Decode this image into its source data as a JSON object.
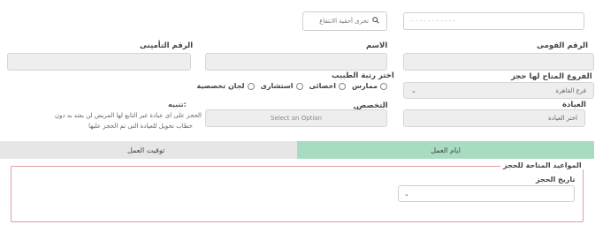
{
  "top": {
    "national_id_value": "- - - - - - - - -  - -",
    "search_placeholder": "تحرى أحقية الانتفاع"
  },
  "labels": {
    "national_id": "الرقم القومى",
    "name": "الاسم",
    "insurance_number": "الرقم التأمينى",
    "branches": "الفروع المتاح لها حجز",
    "doctor_rank": "اختر رتبة الطبيب",
    "clinic": "العيادة",
    "specialty": "التخصص",
    "note_title": "تنبيه:",
    "note_text_line1": "الحجز على اى عيادة غير التابع لها المريض لن يعتد به دون",
    "note_text_line2": "خطاب تحويل للعيادة التى تم الحجز عليها"
  },
  "selects": {
    "branch_value": "فرع القاهرة",
    "clinic_value": "اختر العيادة",
    "specialty_placeholder": "Select an Option"
  },
  "radios": [
    {
      "label": "ممارس"
    },
    {
      "label": "اخصائى"
    },
    {
      "label": "استشارى"
    },
    {
      "label": "لجان تخصصية"
    }
  ],
  "tabs": {
    "work_days": "ايام العمل",
    "work_time": "توقيت العمل"
  },
  "appointments": {
    "legend": "المواعيد المتاحة للحجز",
    "date_label": "تاريخ الحجز"
  },
  "colors": {
    "active_tab": "#a8dcc0",
    "inactive_tab": "#e6e6e6",
    "fieldset_border": "#e0a0a0"
  }
}
